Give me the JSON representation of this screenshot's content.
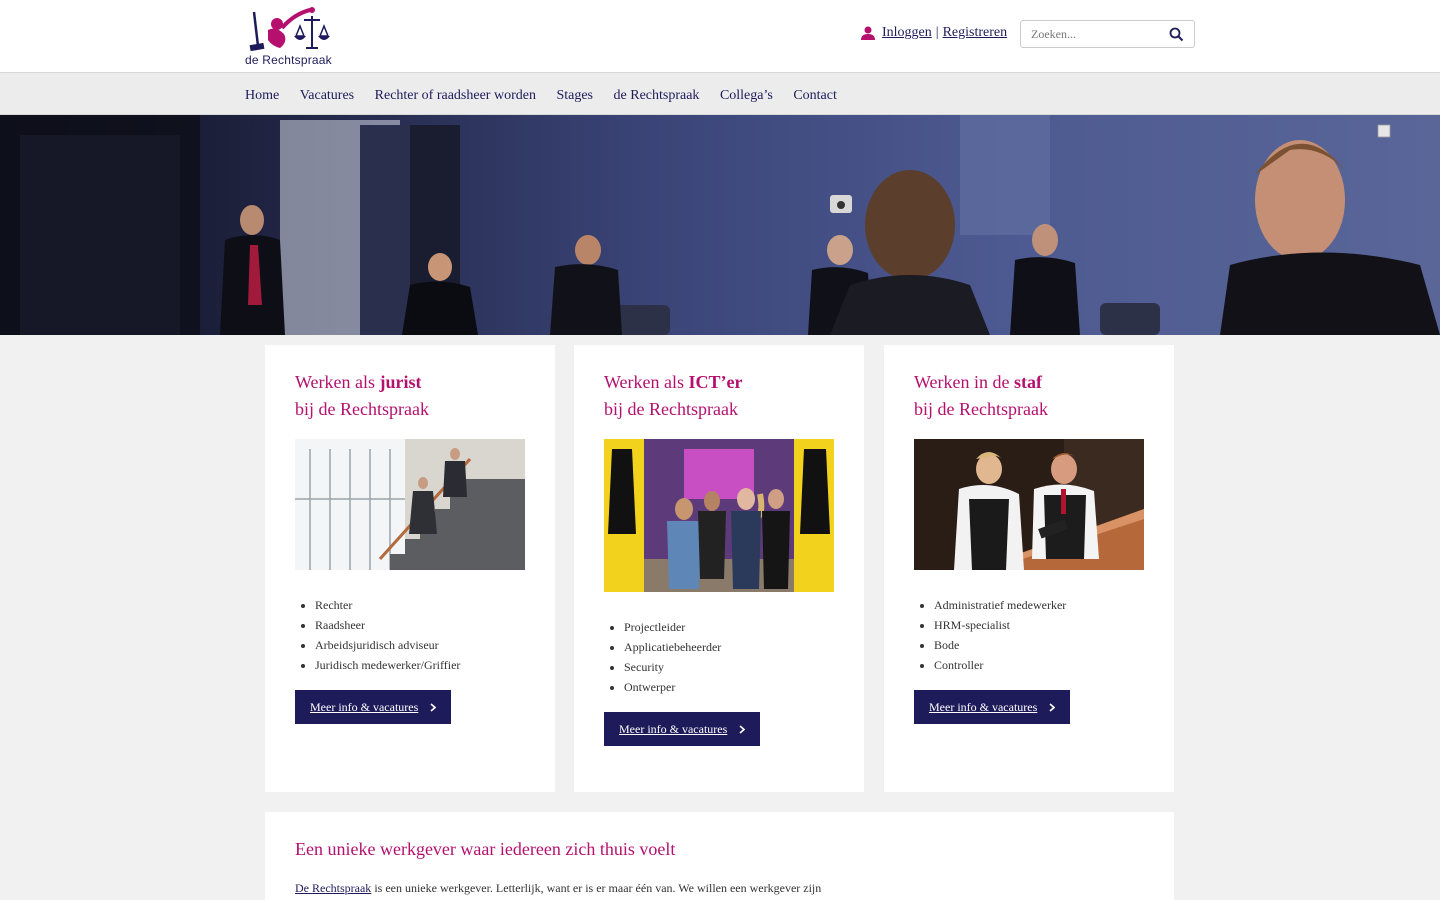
{
  "brand": {
    "name": "de Rechtspraak",
    "primary_color": "#1e1b5a",
    "accent_color": "#b5106e"
  },
  "header": {
    "login_label": "Inloggen",
    "separator": "|",
    "register_label": "Registreren",
    "search_placeholder": "Zoeken..."
  },
  "nav": {
    "items": [
      {
        "label": "Home"
      },
      {
        "label": "Vacatures"
      },
      {
        "label": "Rechter of raadsheer worden"
      },
      {
        "label": "Stages"
      },
      {
        "label": "de Rechtspraak"
      },
      {
        "label": "Collega’s"
      },
      {
        "label": "Contact"
      }
    ]
  },
  "cards": [
    {
      "title_prefix": "Werken als ",
      "title_bold": "jurist",
      "title_line2": "bij de Rechtspraak",
      "image_alt": "stairway-photo",
      "items": [
        "Rechter",
        "Raadsheer",
        "Arbeidsjuridisch adviseur",
        "Juridisch medewerker/Griffier"
      ],
      "button_label": "Meer info & vacatures"
    },
    {
      "title_prefix": "Werken als ",
      "title_bold": "ICT’er",
      "title_line2": "bij de Rechtspraak",
      "image_alt": "ict-team-photo",
      "items": [
        "Projectleider",
        "Applicatiebeheerder",
        "Security",
        "Ontwerper"
      ],
      "button_label": "Meer info & vacatures"
    },
    {
      "title_prefix": "Werken in de ",
      "title_bold": "staf",
      "title_line2": "bij de Rechtspraak",
      "image_alt": "staff-desk-photo",
      "items": [
        "Administratief medewerker",
        "HRM-specialist",
        "Bode",
        "Controller"
      ],
      "button_label": "Meer info & vacatures"
    }
  ],
  "intro": {
    "heading": "Een unieke werkgever waar iedereen zich thuis voelt",
    "link_text": "De Rechtspraak",
    "text": " is een unieke werkgever. Letterlijk, want er is er maar één van. We willen een werkgever zijn"
  }
}
